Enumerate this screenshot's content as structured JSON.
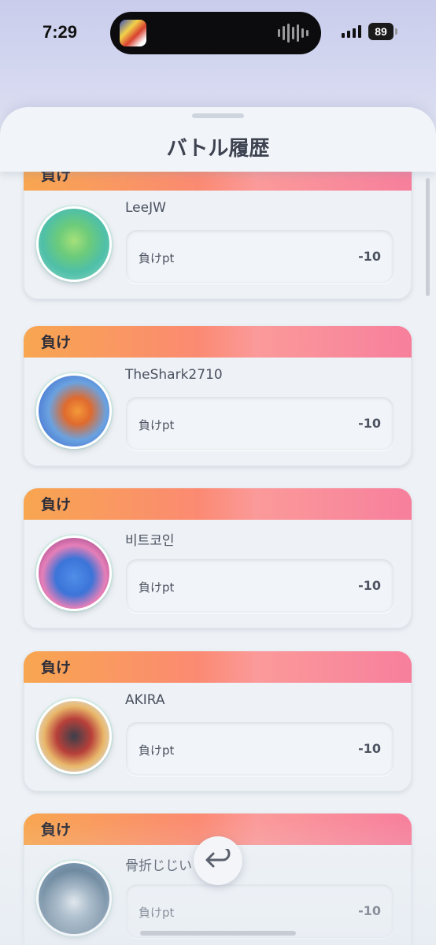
{
  "status_bar": {
    "time": "7:29",
    "battery": "89"
  },
  "sheet": {
    "title": "バトル履歴"
  },
  "battles": [
    {
      "result": "負け",
      "player": "LeeJW",
      "pt_label": "負けpt",
      "pt_value": "-10"
    },
    {
      "result": "負け",
      "player": "TheShark2710",
      "pt_label": "負けpt",
      "pt_value": "-10"
    },
    {
      "result": "負け",
      "player": "비트코인",
      "pt_label": "負けpt",
      "pt_value": "-10"
    },
    {
      "result": "負け",
      "player": "AKIRA",
      "pt_label": "負けpt",
      "pt_value": "-10"
    },
    {
      "result": "負け",
      "player": "骨折じじい",
      "pt_label": "負けpt",
      "pt_value": "-10"
    }
  ],
  "colors": {
    "loss_banner_start": "#f8a650",
    "loss_banner_end": "#f77f9c"
  },
  "icons": {
    "back": "return-arrow-icon"
  }
}
